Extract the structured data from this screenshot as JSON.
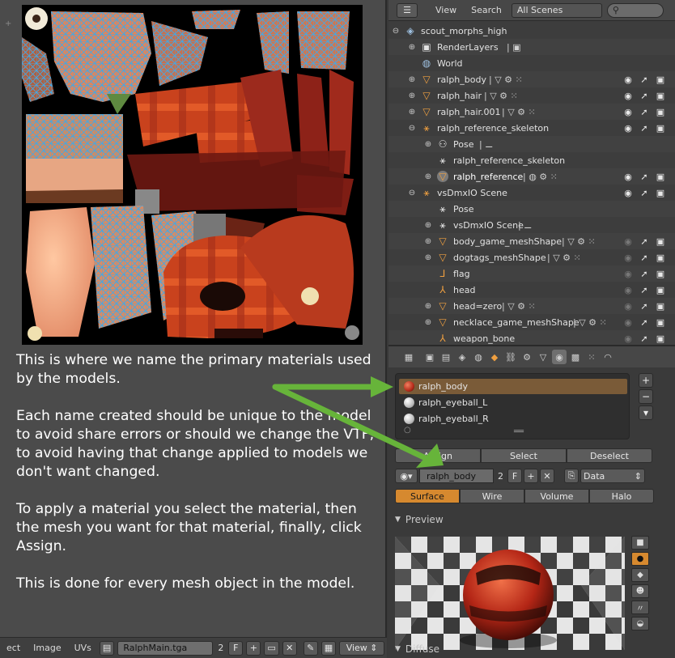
{
  "uv_editor": {
    "annotation": [
      "This is where we name the primary materials used by the models.",
      "Each name created should be unique to the model to avoid share errors or should we change the VTF, to avoid having that change applied to models we don't want changed.",
      "To apply a material you select the material, then the mesh you want for that material, finally, click Assign.",
      "This is done for every mesh object in the model."
    ],
    "header": {
      "menu_select": "ect",
      "menu_image": "Image",
      "menu_uvs": "UVs",
      "image_name": "RalphMain.tga",
      "users": "2",
      "fake_user": "F",
      "view_select": "View"
    }
  },
  "outliner": {
    "header": {
      "view_menu": "View",
      "search_menu": "Search",
      "scenes_select": "All Scenes"
    },
    "rows": [
      {
        "label": "scout_morphs_high"
      },
      {
        "label": "RenderLayers"
      },
      {
        "label": "World"
      },
      {
        "label": "ralph_body"
      },
      {
        "label": "ralph_hair"
      },
      {
        "label": "ralph_hair.001"
      },
      {
        "label": "ralph_reference_skeleton"
      },
      {
        "label": "Pose"
      },
      {
        "label": "ralph_reference_skeleton"
      },
      {
        "label": "ralph_reference"
      },
      {
        "label": "vsDmxIO Scene"
      },
      {
        "label": "Pose"
      },
      {
        "label": "vsDmxIO Scene"
      },
      {
        "label": "body_game_meshShape"
      },
      {
        "label": "dogtags_meshShape"
      },
      {
        "label": "flag"
      },
      {
        "label": "head"
      },
      {
        "label": "head=zero"
      },
      {
        "label": "necklace_game_meshShape"
      },
      {
        "label": "weapon_bone"
      }
    ]
  },
  "properties": {
    "material_slots": [
      {
        "name": "ralph_body",
        "color": "#c0392b"
      },
      {
        "name": "ralph_eyeball_L",
        "color": "#d8d8d8"
      },
      {
        "name": "ralph_eyeball_R",
        "color": "#d8d8d8"
      }
    ],
    "slot_buttons": {
      "assign": "Assign",
      "select": "Select",
      "deselect": "Deselect"
    },
    "datablock": {
      "material_name": "ralph_body",
      "users": "2",
      "fake_user": "F",
      "link": "Data"
    },
    "shading_tabs": [
      "Surface",
      "Wire",
      "Volume",
      "Halo"
    ],
    "panels": {
      "preview": "Preview",
      "diffuse": "Diffuse"
    }
  },
  "colors": {
    "accent": "#d6892f",
    "arrow": "#67b43a",
    "uv_wire": "#3fa9e8"
  }
}
